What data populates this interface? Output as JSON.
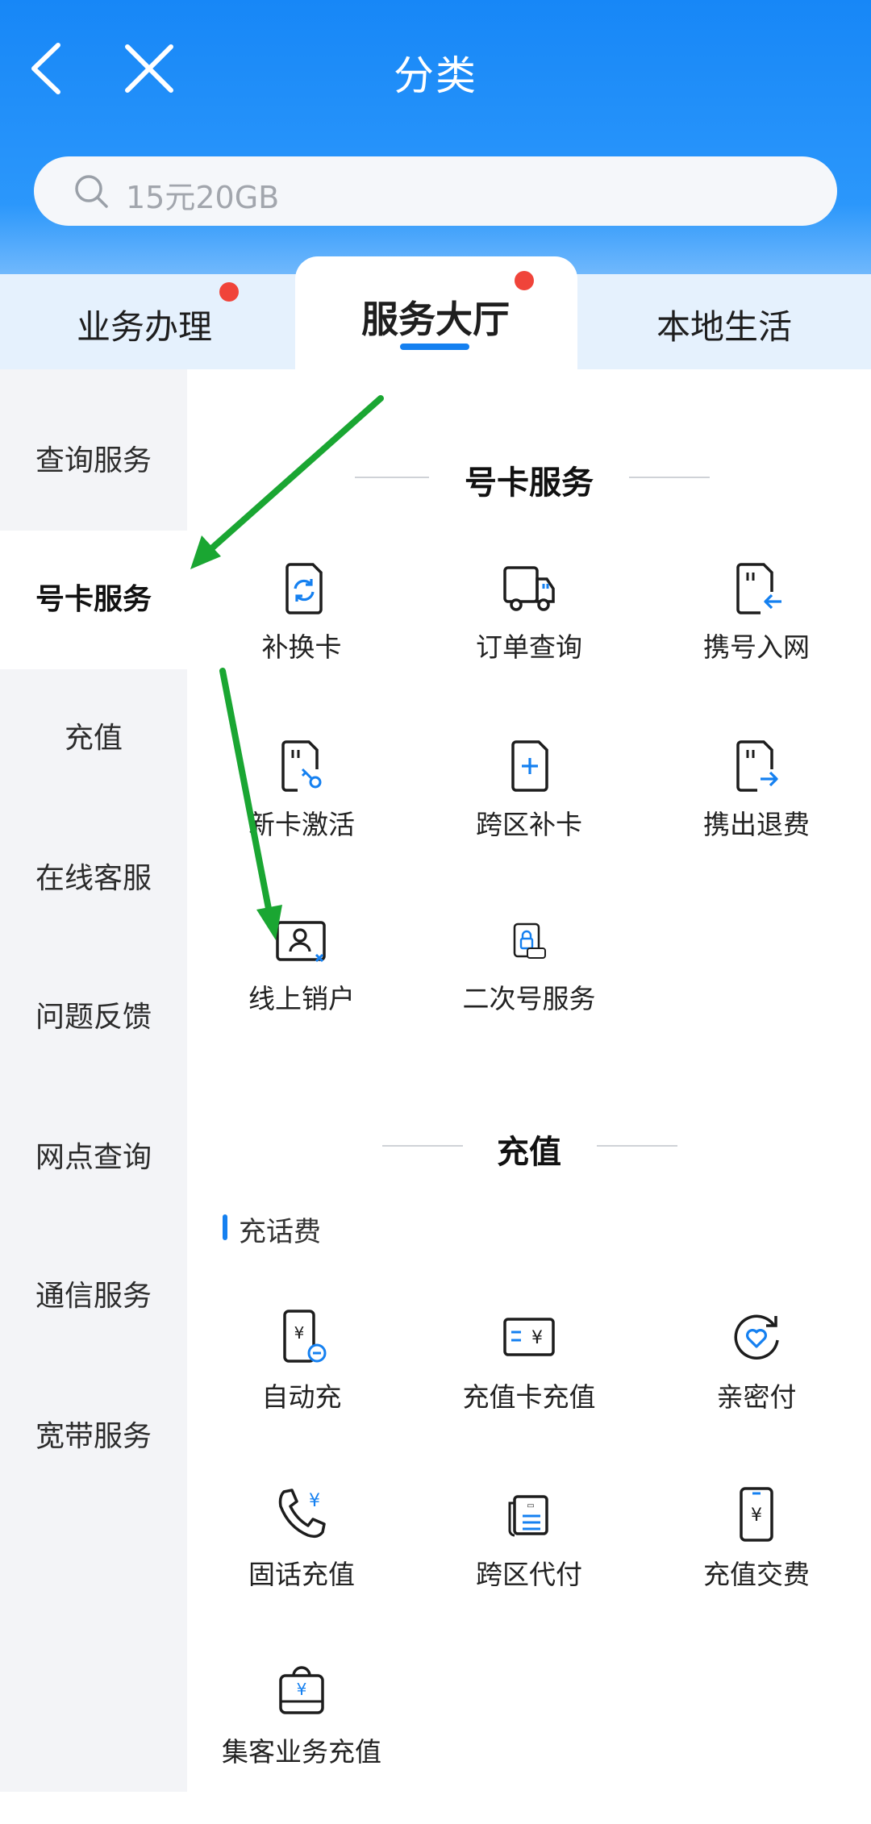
{
  "header": {
    "title": "分类",
    "search_placeholder": "15元20GB"
  },
  "tabs": [
    {
      "label": "业务办理",
      "badge": true
    },
    {
      "label": "服务大厅",
      "badge": true,
      "active": true
    },
    {
      "label": "本地生活",
      "badge": false
    }
  ],
  "sidebar": {
    "items": [
      {
        "label": "查询服务"
      },
      {
        "label": "号卡服务",
        "active": true
      },
      {
        "label": "充值"
      },
      {
        "label": "在线客服"
      },
      {
        "label": "问题反馈"
      },
      {
        "label": "网点查询"
      },
      {
        "label": "通信服务"
      },
      {
        "label": "宽带服务"
      }
    ]
  },
  "sections": {
    "card": {
      "title": "号卡服务",
      "items": [
        {
          "label": "补换卡",
          "icon": "sim-swap-icon"
        },
        {
          "label": "订单查询",
          "icon": "truck-icon"
        },
        {
          "label": "携号入网",
          "icon": "sim-in-icon"
        },
        {
          "label": "新卡激活",
          "icon": "sim-key-icon"
        },
        {
          "label": "跨区补卡",
          "icon": "card-plus-icon"
        },
        {
          "label": "携出退费",
          "icon": "sim-out-icon"
        },
        {
          "label": "线上销户",
          "icon": "id-card-icon"
        },
        {
          "label": "二次号服务",
          "icon": "app-lock-icon"
        }
      ]
    },
    "recharge": {
      "title": "充值",
      "subtitle": "充话费",
      "items": [
        {
          "label": "自动充",
          "icon": "phone-yen-icon"
        },
        {
          "label": "充值卡充值",
          "icon": "yen-card-icon"
        },
        {
          "label": "亲密付",
          "icon": "heart-refresh-icon"
        },
        {
          "label": "固话充值",
          "icon": "telephone-yen-icon"
        },
        {
          "label": "跨区代付",
          "icon": "document-pay-icon"
        },
        {
          "label": "充值交费",
          "icon": "phone-yen-icon"
        },
        {
          "label": "集客业务充值",
          "icon": "bag-yen-icon"
        }
      ]
    }
  },
  "colors": {
    "header_blue": "#1787f7",
    "accent": "#1580f0",
    "badge_red": "#f0443a",
    "annotation_green": "#1aa632"
  }
}
